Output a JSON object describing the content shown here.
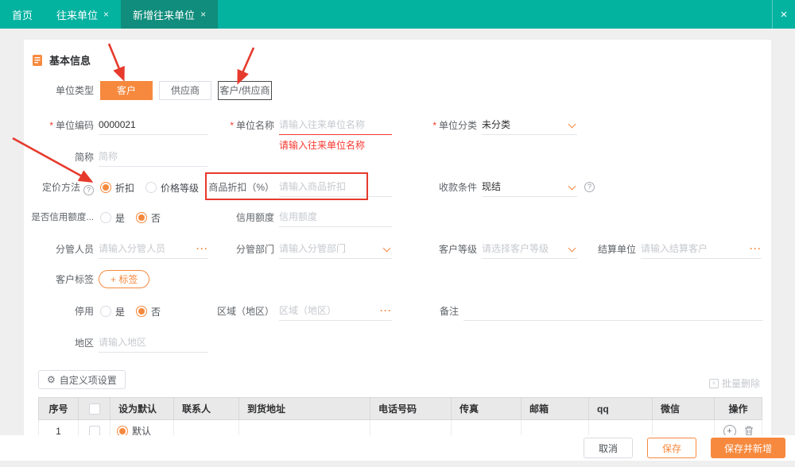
{
  "topbar": {
    "tabs": [
      {
        "label": "首页",
        "closable": false,
        "active": false
      },
      {
        "label": "往来单位",
        "closable": true,
        "active": false
      },
      {
        "label": "新增往来单位",
        "closable": true,
        "active": true
      }
    ]
  },
  "icons": {
    "close": "×",
    "more": "···",
    "help": "?",
    "gear": "⚙",
    "plus": "+"
  },
  "misc": {
    "required_mark": "*"
  },
  "section": {
    "title": "基本信息"
  },
  "unit_type": {
    "label": "单位类型",
    "options": [
      {
        "label": "客户",
        "selected": true
      },
      {
        "label": "供应商",
        "selected": false
      },
      {
        "label": "客户/供应商",
        "selected": false
      }
    ]
  },
  "fields": {
    "unit_code": {
      "label": "单位编码",
      "value": "0000021"
    },
    "unit_name": {
      "label": "单位名称",
      "placeholder": "请输入往来单位名称",
      "error": "请输入往来单位名称"
    },
    "unit_category": {
      "label": "单位分类",
      "value": "未分类"
    },
    "short_name": {
      "label": "简称",
      "placeholder": "简称"
    },
    "pricing_method": {
      "label": "定价方法",
      "options": [
        {
          "label": "折扣",
          "selected": true
        },
        {
          "label": "价格等级",
          "selected": false
        }
      ]
    },
    "product_discount": {
      "label": "商品折扣（%）",
      "placeholder": "请输入商品折扣"
    },
    "payment_terms": {
      "label": "收款条件",
      "value": "现结"
    },
    "credit_limit_toggle": {
      "label": "是否信用额度...",
      "options": [
        {
          "label": "是",
          "selected": false
        },
        {
          "label": "否",
          "selected": true
        }
      ]
    },
    "credit_limit": {
      "label": "信用额度",
      "placeholder": "信用额度"
    },
    "manager": {
      "label": "分管人员",
      "placeholder": "请输入分管人员"
    },
    "department": {
      "label": "分管部门",
      "placeholder": "请输入分管部门"
    },
    "customer_level": {
      "label": "客户等级",
      "placeholder": "请选择客户等级"
    },
    "settlement_unit": {
      "label": "结算单位",
      "placeholder": "请输入结算客户"
    },
    "customer_tags": {
      "label": "客户标签",
      "add_button": "+ 标签"
    },
    "disabled_toggle": {
      "label": "停用",
      "options": [
        {
          "label": "是",
          "selected": false
        },
        {
          "label": "否",
          "selected": true
        }
      ]
    },
    "region": {
      "label": "区域（地区）",
      "placeholder": "区域（地区）"
    },
    "remarks": {
      "label": "备注",
      "value": ""
    },
    "area": {
      "label": "地区",
      "placeholder": "请输入地区"
    }
  },
  "toolbar": {
    "custom_settings": "自定义项设置",
    "batch_delete": "批量删除"
  },
  "contact_table": {
    "headers": [
      "序号",
      "设为默认",
      "联系人",
      "到货地址",
      "电话号码",
      "传真",
      "邮箱",
      "qq",
      "微信",
      "操作"
    ],
    "rows": [
      {
        "index": "1",
        "default_label": "默认",
        "default_selected": true
      }
    ]
  },
  "footer": {
    "cancel": "取消",
    "save": "保存",
    "save_and_new": "保存并新增"
  },
  "colors": {
    "accent": "#f6893d",
    "teal": "#04b2a0",
    "teal_dark": "#108d7c",
    "error": "#f5392f",
    "annotation": "#e63a2d"
  }
}
